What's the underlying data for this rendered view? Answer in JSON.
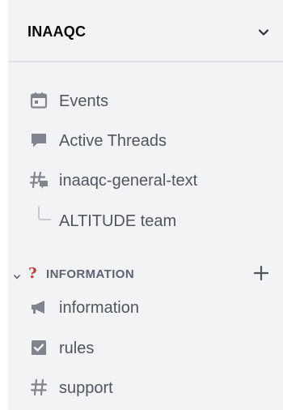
{
  "server": {
    "name": "INAAQC",
    "menu_icon": "chevron-down-icon"
  },
  "channels": [
    {
      "label": "Events",
      "icon": "calendar-icon"
    },
    {
      "label": "Active Threads",
      "icon": "threads-icon"
    },
    {
      "label": "inaaqc-general-text",
      "icon": "text-channel-thread-icon"
    },
    {
      "label": "ALTITUDE team",
      "icon": "thread-branch-icon"
    }
  ],
  "category": {
    "emoji": "?",
    "label": "INFORMATION",
    "collapse_icon": "chevron-down-icon",
    "add_icon": "plus-icon",
    "emoji_color": "#d0302f"
  },
  "category_channels": [
    {
      "label": "information",
      "icon": "announcement-icon"
    },
    {
      "label": "rules",
      "icon": "rules-checkbox-icon"
    },
    {
      "label": "support",
      "icon": "hashtag-icon"
    }
  ],
  "colors": {
    "sidebar_bg": "#f2f3f5",
    "channel_text": "#4f5660",
    "icon": "#80848e"
  }
}
